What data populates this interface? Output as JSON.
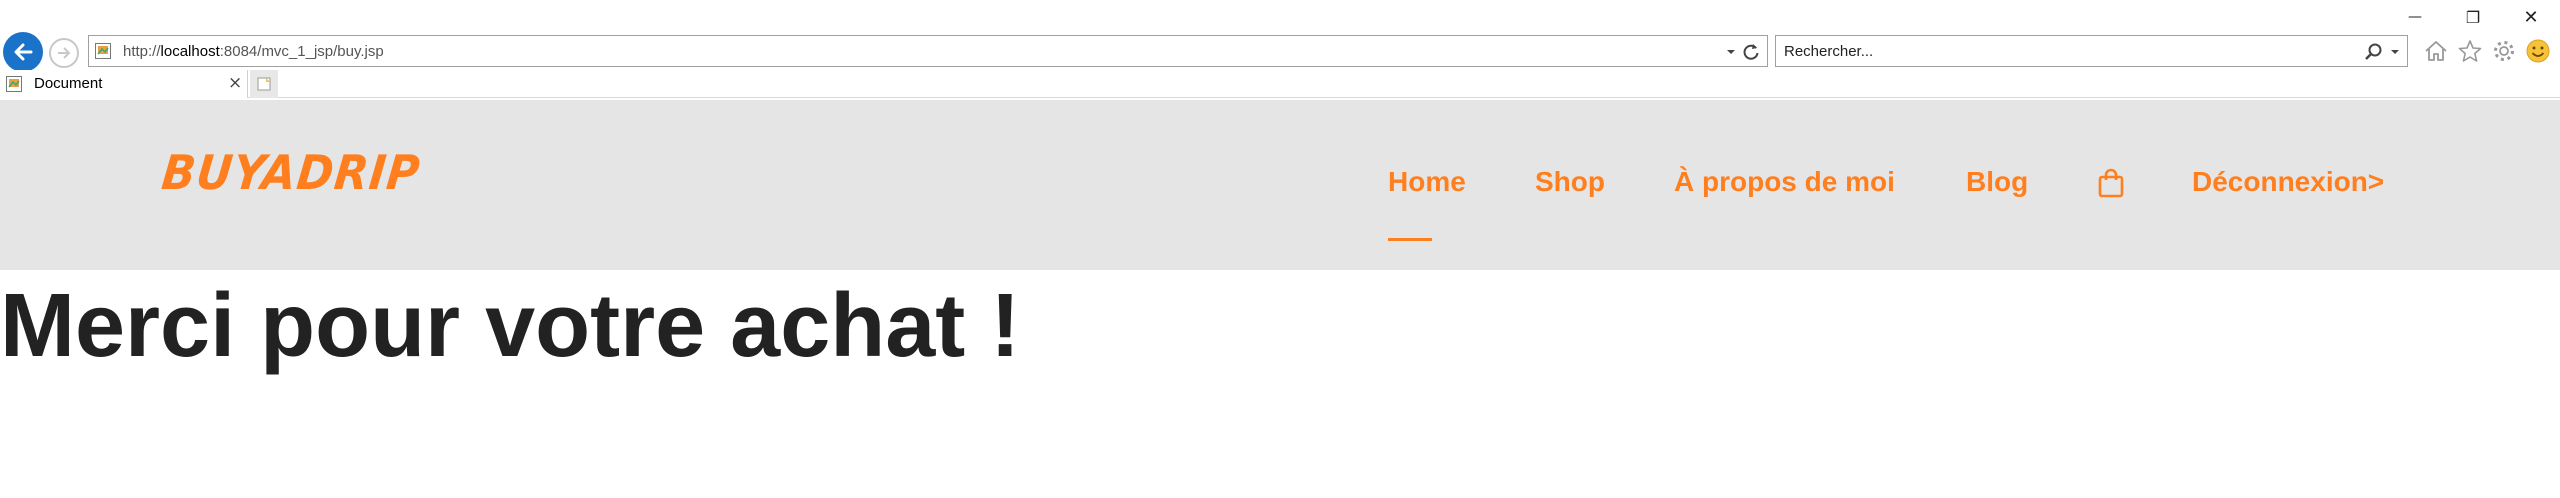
{
  "browser": {
    "address": {
      "url_prefix": "http://",
      "url_host": "localhost",
      "url_rest": ":8084/mvc_1_jsp/buy.jsp"
    },
    "search": {
      "placeholder": "Rechercher..."
    },
    "tab": {
      "title": "Document",
      "close": "×"
    },
    "window_controls": {
      "minimize": "—",
      "restore": "❐",
      "close": "✕"
    },
    "icons": [
      "back-icon",
      "forward-icon",
      "refresh-icon",
      "search-icon",
      "home-icon",
      "star-icon",
      "gear-icon",
      "smiley-icon"
    ]
  },
  "site": {
    "logo": "BUYADRIP",
    "nav": {
      "home": "Home",
      "shop": "Shop",
      "about": "À propos de moi",
      "blog": "Blog",
      "logout": "Déconnexion>"
    },
    "accent_color": "#ff7f1f",
    "header_bg": "#e5e5e5",
    "active_item": "Home"
  },
  "main": {
    "heading": "Merci pour votre achat !"
  }
}
